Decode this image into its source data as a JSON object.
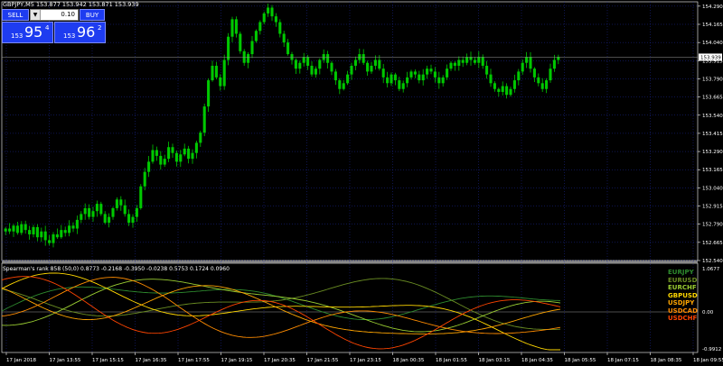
{
  "symbol_header": "GBPJPY,M5  153.877 153.942 153.871 153.939",
  "trade_panel": {
    "sell_label": "SELL",
    "buy_label": "BUY",
    "lot_value": "0.10",
    "lot_arrow": "▼",
    "sell_price_small": "153",
    "sell_price_big": "95",
    "sell_price_sup": "4",
    "buy_price_small": "153",
    "buy_price_big": "96",
    "buy_price_sup": "2"
  },
  "price_axis": {
    "ticks": [
      "154.290",
      "154.165",
      "154.040",
      "153.915",
      "153.790",
      "153.665",
      "153.540",
      "153.415",
      "153.290",
      "153.165",
      "153.040",
      "152.915",
      "152.790",
      "152.665",
      "152.540"
    ],
    "current_price": "153.939"
  },
  "indicator": {
    "header": "Spearman's rank 858 (50,0) 0.8773 -0.2168 -0.3950 -0.0238 0.5753 0.1724 0.0960",
    "axis_top": "1.0677",
    "axis_mid": "0.00",
    "axis_bottom": "-0.9912",
    "legend": [
      {
        "label": "EURJPY",
        "color": "#2e8b2e"
      },
      {
        "label": "EURUSD",
        "color": "#6b8e23"
      },
      {
        "label": "EURCHF",
        "color": "#9acd32"
      },
      {
        "label": "GBPUSD",
        "color": "#ffd700"
      },
      {
        "label": "USDJPY",
        "color": "#ffa500"
      },
      {
        "label": "USDCAD",
        "color": "#ff8c00"
      },
      {
        "label": "USDCHF",
        "color": "#ff4500"
      }
    ]
  },
  "time_axis": [
    "17 Jan 2018",
    "17 Jan 13:55",
    "17 Jan 15:15",
    "17 Jan 16:35",
    "17 Jan 17:55",
    "17 Jan 19:15",
    "17 Jan 20:35",
    "17 Jan 21:55",
    "17 Jan 23:15",
    "18 Jan 00:35",
    "18 Jan 01:55",
    "18 Jan 03:15",
    "18 Jan 04:35",
    "18 Jan 05:55",
    "18 Jan 07:15",
    "18 Jan 08:35",
    "18 Jan 09:55"
  ],
  "colors": {
    "candle": "#00c800",
    "grid": "#1e2aa0",
    "axis": "#ffffff",
    "background": "#000000"
  },
  "chart_data": {
    "type": "bar",
    "title": "GBPJPY,M5",
    "ylim": [
      152.54,
      154.32
    ],
    "series": [
      {
        "name": "GBPJPY M5 close",
        "values": [
          152.76,
          152.74,
          152.78,
          152.73,
          152.79,
          152.75,
          152.72,
          152.77,
          152.7,
          152.74,
          152.68,
          152.66,
          152.72,
          152.7,
          152.75,
          152.73,
          152.78,
          152.76,
          152.82,
          152.86,
          152.9,
          152.84,
          152.88,
          152.93,
          152.86,
          152.8,
          152.84,
          152.9,
          152.96,
          152.92,
          152.86,
          152.8,
          152.84,
          152.9,
          153.05,
          153.15,
          153.22,
          153.3,
          153.26,
          153.2,
          153.24,
          153.32,
          153.28,
          153.22,
          153.27,
          153.31,
          153.24,
          153.28,
          153.35,
          153.42,
          153.6,
          153.78,
          153.88,
          153.8,
          153.74,
          153.92,
          154.08,
          154.2,
          154.1,
          153.98,
          153.9,
          153.96,
          154.05,
          154.12,
          154.18,
          154.24,
          154.28,
          154.22,
          154.18,
          154.1,
          154.04,
          153.96,
          153.92,
          153.86,
          153.9,
          153.94,
          153.88,
          153.82,
          153.86,
          153.92,
          153.96,
          153.9,
          153.84,
          153.78,
          153.72,
          153.76,
          153.82,
          153.88,
          153.92,
          153.96,
          153.9,
          153.84,
          153.88,
          153.92,
          153.86,
          153.8,
          153.76,
          153.82,
          153.78,
          153.72,
          153.76,
          153.8,
          153.84,
          153.82,
          153.78,
          153.82,
          153.86,
          153.84,
          153.8,
          153.76,
          153.8,
          153.86,
          153.9,
          153.88,
          153.92,
          153.9,
          153.94,
          153.92,
          153.9,
          153.94,
          153.88,
          153.82,
          153.76,
          153.72,
          153.7,
          153.74,
          153.68,
          153.72,
          153.78,
          153.84,
          153.9,
          153.94,
          153.86,
          153.8,
          153.76,
          153.72,
          153.78,
          153.86,
          153.92,
          153.94
        ]
      }
    ]
  }
}
